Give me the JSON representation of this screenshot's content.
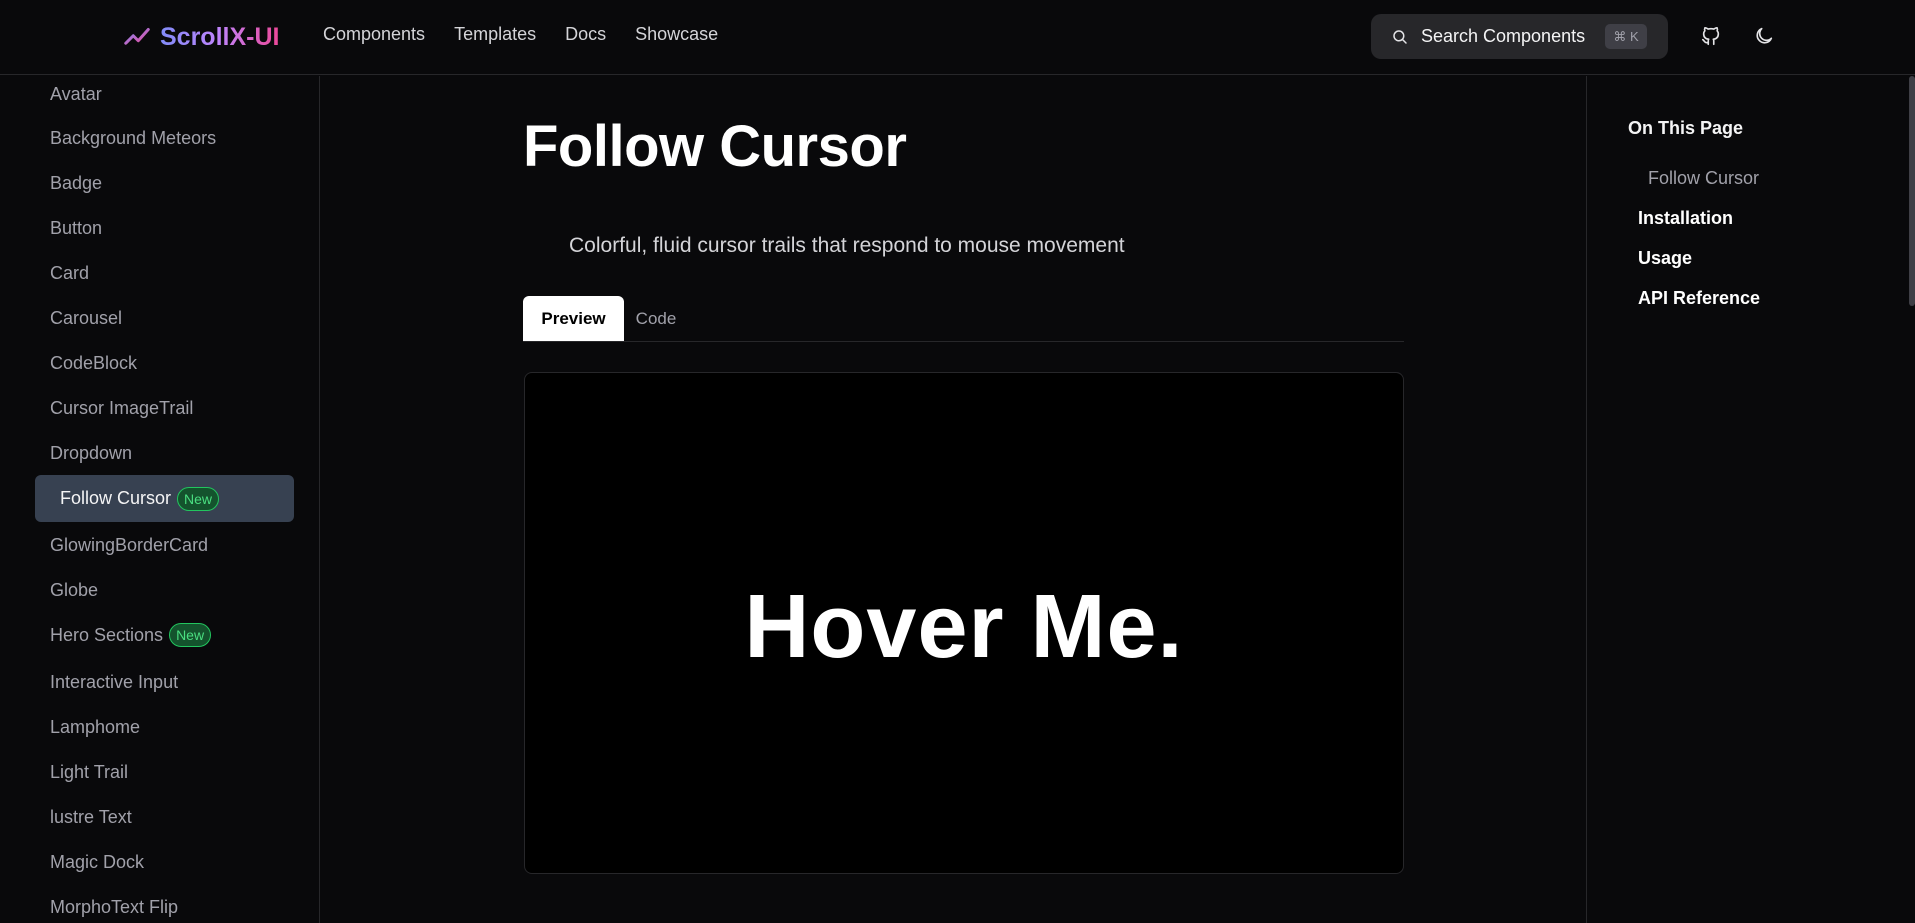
{
  "header": {
    "logo_text": "ScrollX-UI",
    "nav": [
      "Components",
      "Templates",
      "Docs",
      "Showcase"
    ],
    "search_label": "Search Components",
    "search_shortcut": "⌘ K"
  },
  "sidebar": {
    "items": [
      {
        "label": "Avatar"
      },
      {
        "label": "Background Meteors"
      },
      {
        "label": "Badge"
      },
      {
        "label": "Button"
      },
      {
        "label": "Card"
      },
      {
        "label": "Carousel"
      },
      {
        "label": "CodeBlock"
      },
      {
        "label": "Cursor ImageTrail"
      },
      {
        "label": "Dropdown"
      },
      {
        "label": "Follow Cursor",
        "badge": "New",
        "active": true
      },
      {
        "label": "GlowingBorderCard"
      },
      {
        "label": "Globe"
      },
      {
        "label": "Hero Sections",
        "badge": "New"
      },
      {
        "label": "Interactive Input"
      },
      {
        "label": "Lamphome"
      },
      {
        "label": "Light Trail"
      },
      {
        "label": "lustre Text"
      },
      {
        "label": "Magic Dock"
      },
      {
        "label": "MorphoText Flip"
      }
    ]
  },
  "main": {
    "title": "Follow Cursor",
    "description": "Colorful, fluid cursor trails that respond to mouse movement",
    "tabs": [
      "Preview",
      "Code"
    ],
    "preview_text": "Hover Me."
  },
  "toc": {
    "title": "On This Page",
    "items": [
      "Follow Cursor",
      "Installation",
      "Usage",
      "API Reference"
    ]
  },
  "colors": {
    "background": "#09090b",
    "border": "#27272a",
    "active_item": "#374151",
    "badge_green": "#22c55e"
  }
}
